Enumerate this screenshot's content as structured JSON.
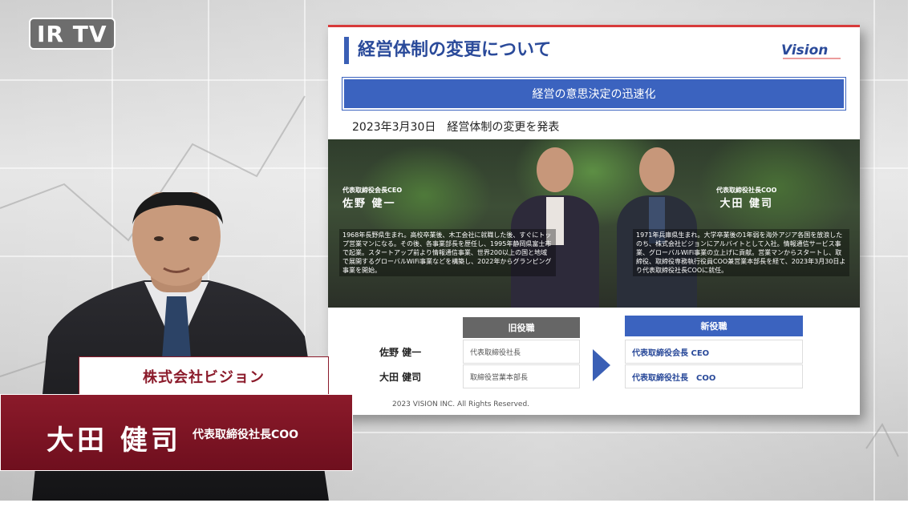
{
  "logo": {
    "text": "IR TV"
  },
  "slide": {
    "title": "経営体制の変更について",
    "brand": "Vision",
    "banner": "経営の意思決定の迅速化",
    "announcement": "2023年3月30日　経営体制の変更を発表",
    "executives": [
      {
        "title": "代表取締役会長CEO",
        "name": "佐野 健一",
        "bio": "1968年長野県生まれ。高校卒業後、木工会社に就職した後、すぐにトップ営業マンになる。その後、各事業部長を歴任し、1995年静岡県富士市で起業。スタートアップ前より情報通信事業、世界200以上の国と地域で展開するグローバルWiFi事業などを構築し、2022年からグランピング事業を開始。"
      },
      {
        "title": "代表取締役社長COO",
        "name": "大田 健司",
        "bio": "1971年兵庫県生まれ。大学卒業後の1年弱を海外アジア各国を放浪したのち、株式会社ビジョンにアルバイトとして入社。情報通信サービス事業、グローバルWiFi事業の立上げに貢献。営業マンからスタートし、取締役、取締役専務執行役員COO兼営業本部長を経て、2023年3月30日より代表取締役社長COOに就任。"
      }
    ],
    "table": {
      "header_old": "旧役職",
      "header_new": "新役職",
      "rows": [
        {
          "name": "佐野 健一",
          "old": "代表取締役社長",
          "new": "代表取締役会長 CEO"
        },
        {
          "name": "大田 健司",
          "old": "取締役営業本部長",
          "new": "代表取締役社長　COO"
        }
      ]
    },
    "copyright": "2023 VISION INC. All Rights Reserved."
  },
  "lower_third": {
    "company": "株式会社ビジョン",
    "name": "大田 健司",
    "title": "代表取締役社長COO"
  },
  "colors": {
    "accent_blue": "#3b63bf",
    "lower_third_red": "#8b1a2a",
    "slide_top_red": "#d83a3a"
  }
}
